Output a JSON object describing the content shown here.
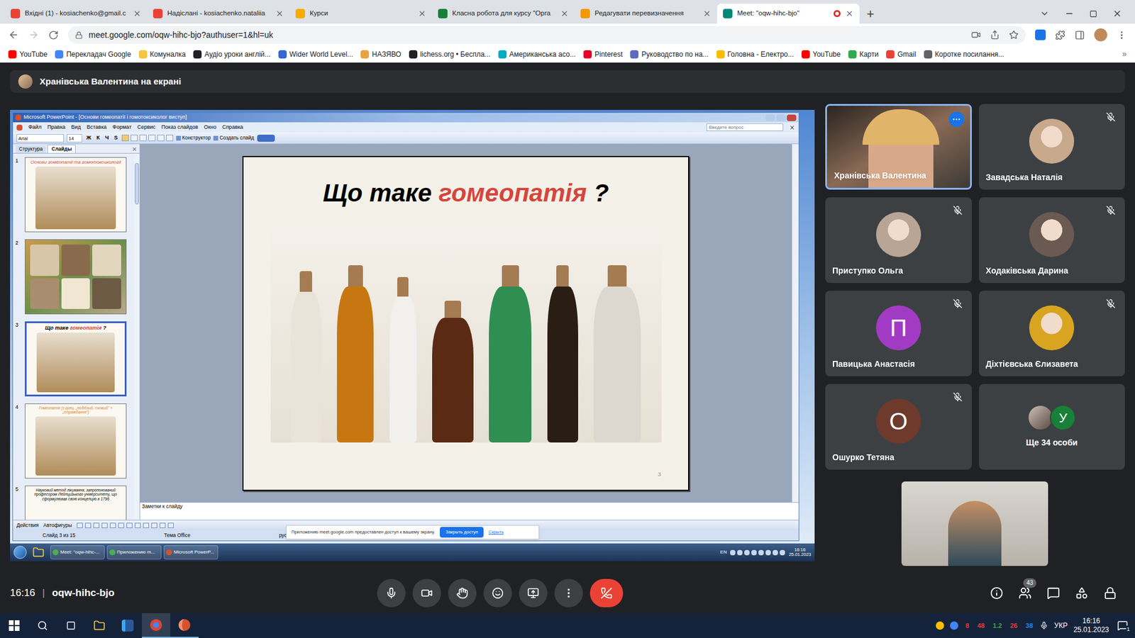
{
  "browser": {
    "tabs": [
      {
        "label": "Вхідні (1) - kosiachenko@gmail.c",
        "selected": false,
        "color": "#ea4335"
      },
      {
        "label": "Надіслані - kosiachenko.nataliia",
        "selected": false,
        "color": "#ea4335"
      },
      {
        "label": "Курси",
        "selected": false,
        "color": "#f9ab00"
      },
      {
        "label": "Класна робота для курсу \"Орга",
        "selected": false,
        "color": "#188038"
      },
      {
        "label": "Редагувати перевизначення",
        "selected": false,
        "color": "#f29900"
      },
      {
        "label": "Meet: \"oqw-hihc-bjo\"",
        "selected": true,
        "color": "#00897b"
      }
    ],
    "new_tab": "+",
    "address": "meet.google.com/oqw-hihc-bjo?authuser=1&hl=uk",
    "bookmarks": [
      {
        "label": "YouTube",
        "color": "#ff0000"
      },
      {
        "label": "Перекладач Google",
        "color": "#4285f4"
      },
      {
        "label": "Комуналка",
        "color": "#f4c542"
      },
      {
        "label": "Аудіо уроки англій...",
        "color": "#202124"
      },
      {
        "label": "Wider World Level...",
        "color": "#3367d6"
      },
      {
        "label": "НАЗЯВО",
        "color": "#e8a33d"
      },
      {
        "label": "lichess.org • Беспла...",
        "color": "#202124"
      },
      {
        "label": "Американська асо...",
        "color": "#00acc1"
      },
      {
        "label": "Pinterest",
        "color": "#e60023"
      },
      {
        "label": "Руководство по на...",
        "color": "#5c6bc0"
      },
      {
        "label": "Головна - Електро...",
        "color": "#fbbc04"
      },
      {
        "label": "YouTube",
        "color": "#ff0000"
      },
      {
        "label": "Карти",
        "color": "#34a853"
      },
      {
        "label": "Gmail",
        "color": "#ea4335"
      },
      {
        "label": "Коротке посилання...",
        "color": "#5f6368"
      }
    ],
    "more_bookmarks": "»"
  },
  "presenter_banner": "Хранівська Валентина на екрані",
  "shared_screen": {
    "ppt": {
      "title": "Microsoft PowerPoint - [Основи гомеопатії і гомотоксиколог виступ]",
      "menu": [
        "Файл",
        "Правка",
        "Вид",
        "Вставка",
        "Формат",
        "Сервис",
        "Показ слайдов",
        "Окно",
        "Справка"
      ],
      "font": "Arial",
      "font_size": "14",
      "format_buttons": [
        "Ж",
        "К",
        "Ч",
        "S"
      ],
      "toolbar_buttons": [
        "Конструктор",
        "Создать слайд"
      ],
      "help_placeholder": "Введите вопрос",
      "panel_tabs": [
        {
          "label": "Структура",
          "selected": false
        },
        {
          "label": "Слайды",
          "selected": true
        }
      ],
      "thumbnails": [
        {
          "number": "1",
          "kind": "title",
          "selected": false,
          "title": [
            {
              "text": "Основи гомеопатії та гомотоксикології",
              "highlight": true
            }
          ]
        },
        {
          "number": "2",
          "kind": "photo",
          "selected": false,
          "title": []
        },
        {
          "number": "3",
          "kind": "title",
          "selected": true,
          "title": [
            {
              "text": "Що таке ",
              "highlight": false
            },
            {
              "text": "гомеопатія",
              "highlight": true
            },
            {
              "text": " ?",
              "highlight": false
            }
          ]
        },
        {
          "number": "4",
          "kind": "title",
          "selected": false,
          "title": [
            {
              "text": "Гомеопатія (з грец. „подібний, схожий\" + „страждання\")",
              "highlight": true
            }
          ]
        },
        {
          "number": "5",
          "kind": "text",
          "selected": false,
          "title": [
            {
              "text": "Науковий метод лікування, запропонований професором Лейпцизького університету, що сформулював свою концепцію в 1796",
              "highlight": false
            }
          ]
        }
      ],
      "slide": {
        "title": [
          {
            "text": "Що таке ",
            "highlight": false
          },
          {
            "text": "гомеопатія",
            "highlight": true
          },
          {
            "text": " ?",
            "highlight": false
          }
        ],
        "number": "3"
      },
      "notes_placeholder": "Заметки к слайду",
      "drawing_toolbar": [
        "Действия",
        "Автофигуры"
      ],
      "status": [
        "Слайд 3 из 15",
        "Тема Office",
        "русский (Россия)"
      ]
    },
    "share_notice": {
      "text": "Приложению meet.google.com предоставлен доступ к вашему экрану.",
      "button": "Закрыть доступ",
      "link": "Скрыть"
    },
    "taskbar": {
      "items": [
        "Meet: \"oqw-hihc-...",
        "Приложению m...",
        "Microsoft PowerP..."
      ],
      "language": "EN",
      "time": "16:16",
      "date": "25.01.2023"
    }
  },
  "participants": [
    {
      "name": "Хранівська Валентина",
      "kind": "video",
      "muted": false,
      "speaking": true,
      "initial": "",
      "color": "#8ab4f8"
    },
    {
      "name": "Завадська Наталія",
      "kind": "photo",
      "muted": true,
      "speaking": false,
      "initial": "",
      "color": "#c9a98c"
    },
    {
      "name": "Приступко Ольга",
      "kind": "photo",
      "muted": true,
      "speaking": false,
      "initial": "",
      "color": "#b9a596"
    },
    {
      "name": "Ходаківська Дарина",
      "kind": "photo",
      "muted": true,
      "speaking": false,
      "initial": "",
      "color": "#6b5a52"
    },
    {
      "name": "Павицька Анастасія",
      "kind": "letter",
      "muted": true,
      "speaking": false,
      "initial": "П",
      "color": "#a23bc4"
    },
    {
      "name": "Діхтієвська Єлизавета",
      "kind": "photo",
      "muted": true,
      "speaking": false,
      "initial": "",
      "color": "#d9a520"
    },
    {
      "name": "Ошурко Тетяна",
      "kind": "letter",
      "muted": true,
      "speaking": false,
      "initial": "О",
      "color": "#6d3a2c"
    }
  ],
  "more_participants": {
    "label": "Ще 34 особи",
    "initial": "У",
    "color": "#188038"
  },
  "meeting": {
    "time": "16:16",
    "separator": "|",
    "code": "oqw-hihc-bjo",
    "participant_count": "43"
  },
  "windows_taskbar": {
    "tray_counts": [
      {
        "text": "8",
        "color": "#e53935"
      },
      {
        "text": "48",
        "color": "#e53935"
      },
      {
        "text": "1.2",
        "color": "#43a047"
      },
      {
        "text": "26",
        "color": "#e53935"
      },
      {
        "text": "38",
        "color": "#1e88e5"
      }
    ],
    "language": "УКР",
    "time": "16:16",
    "date": "25.01.2023",
    "notifications": "1"
  }
}
